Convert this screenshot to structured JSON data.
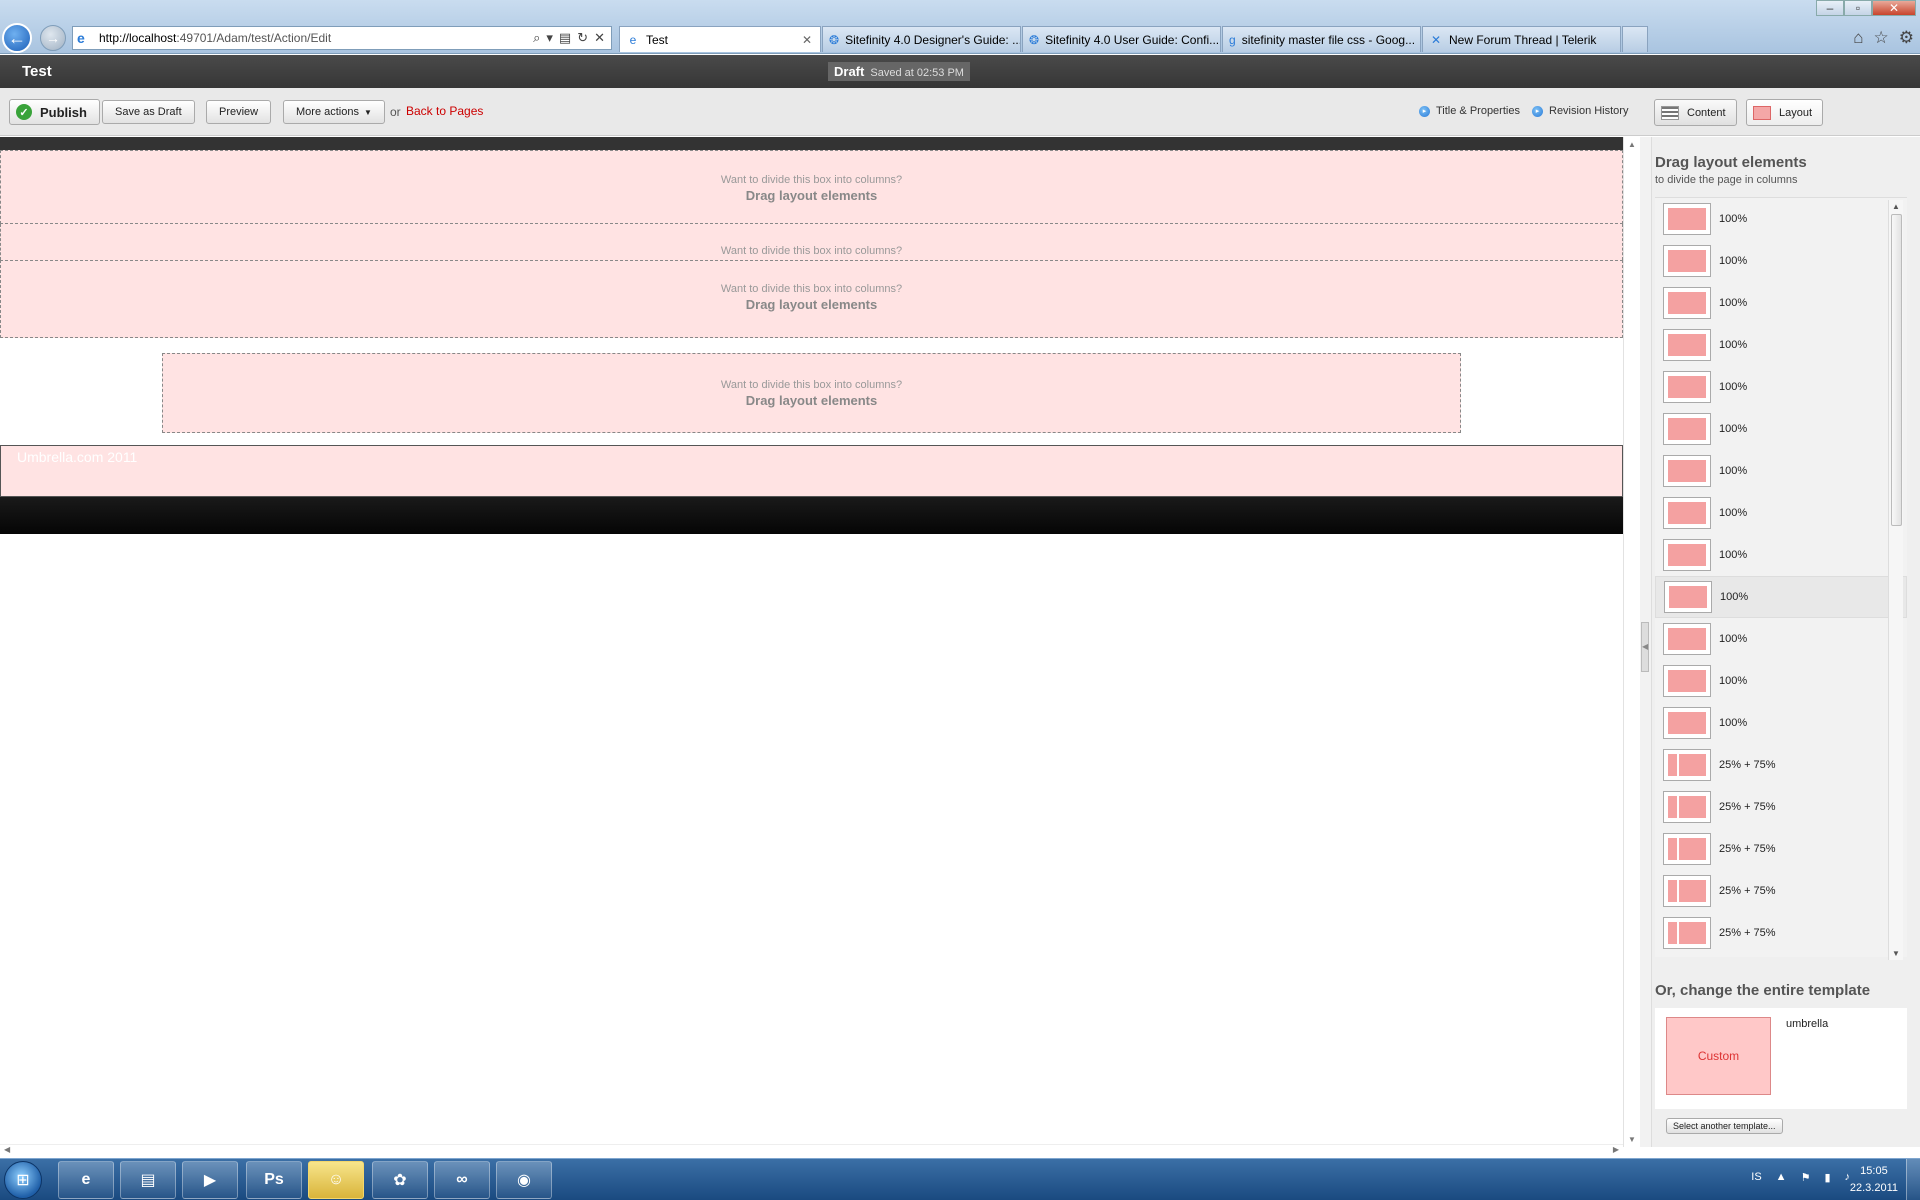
{
  "browser": {
    "url_host": "http://localhost",
    "url_path": ":49701/Adam/test/Action/Edit",
    "window_controls": [
      "–",
      "▫",
      "✕"
    ],
    "tabs": [
      {
        "label": "Test",
        "active": true
      },
      {
        "label": "Sitefinity 4.0 Designer's Guide: ...",
        "active": false
      },
      {
        "label": "Sitefinity 4.0 User Guide: Confi...",
        "active": false
      },
      {
        "label": "sitefinity master file css - Goog...",
        "active": false
      },
      {
        "label": "New Forum Thread | Telerik",
        "active": false
      }
    ]
  },
  "header": {
    "page_title": "Test",
    "status": "Draft",
    "saved_text": "Saved at 02:53 PM"
  },
  "toolbar": {
    "publish_label": "Publish",
    "save_draft_label": "Save as Draft",
    "preview_label": "Preview",
    "more_actions_label": "More actions",
    "or_text": "or",
    "back_link": "Back to Pages",
    "title_properties_label": "Title & Properties",
    "revision_history_label": "Revision History",
    "content_mode_label": "Content",
    "layout_mode_label": "Layout"
  },
  "canvas": {
    "dropzone_hint": "Want to divide this box into columns?",
    "dropzone_drag": "Drag layout elements",
    "footer_text": "Umbrella.com 2011"
  },
  "panel": {
    "title": "Drag layout elements",
    "subtitle": "to divide the page in columns",
    "elements": [
      {
        "label": "100%",
        "split": false
      },
      {
        "label": "100%",
        "split": false
      },
      {
        "label": "100%",
        "split": false
      },
      {
        "label": "100%",
        "split": false
      },
      {
        "label": "100%",
        "split": false
      },
      {
        "label": "100%",
        "split": false
      },
      {
        "label": "100%",
        "split": false
      },
      {
        "label": "100%",
        "split": false
      },
      {
        "label": "100%",
        "split": false
      },
      {
        "label": "100%",
        "split": false,
        "hover": true
      },
      {
        "label": "100%",
        "split": false
      },
      {
        "label": "100%",
        "split": false
      },
      {
        "label": "100%",
        "split": false
      },
      {
        "label": "25% + 75%",
        "split": true
      },
      {
        "label": "25% + 75%",
        "split": true
      },
      {
        "label": "25% + 75%",
        "split": true
      },
      {
        "label": "25% + 75%",
        "split": true
      },
      {
        "label": "25% + 75%",
        "split": true
      }
    ],
    "template_title": "Or, change the entire template",
    "template_thumb_label": "Custom",
    "template_name": "umbrella",
    "select_template_label": "Select another template..."
  },
  "taskbar": {
    "apps": [
      {
        "name": "ie-taskbar-icon",
        "glyph": "e"
      },
      {
        "name": "explorer-taskbar-icon",
        "glyph": "▤"
      },
      {
        "name": "media-player-taskbar-icon",
        "glyph": "▶"
      },
      {
        "name": "photoshop-taskbar-icon",
        "glyph": "Ps"
      },
      {
        "name": "kinderspiel-taskbar-icon",
        "glyph": "☺"
      },
      {
        "name": "colors-taskbar-icon",
        "glyph": "✿"
      },
      {
        "name": "visual-studio-taskbar-icon",
        "glyph": "∞"
      },
      {
        "name": "chrome-taskbar-icon",
        "glyph": "◉"
      }
    ],
    "language": "IS",
    "time": "15:05",
    "date": "22.3.2011"
  }
}
